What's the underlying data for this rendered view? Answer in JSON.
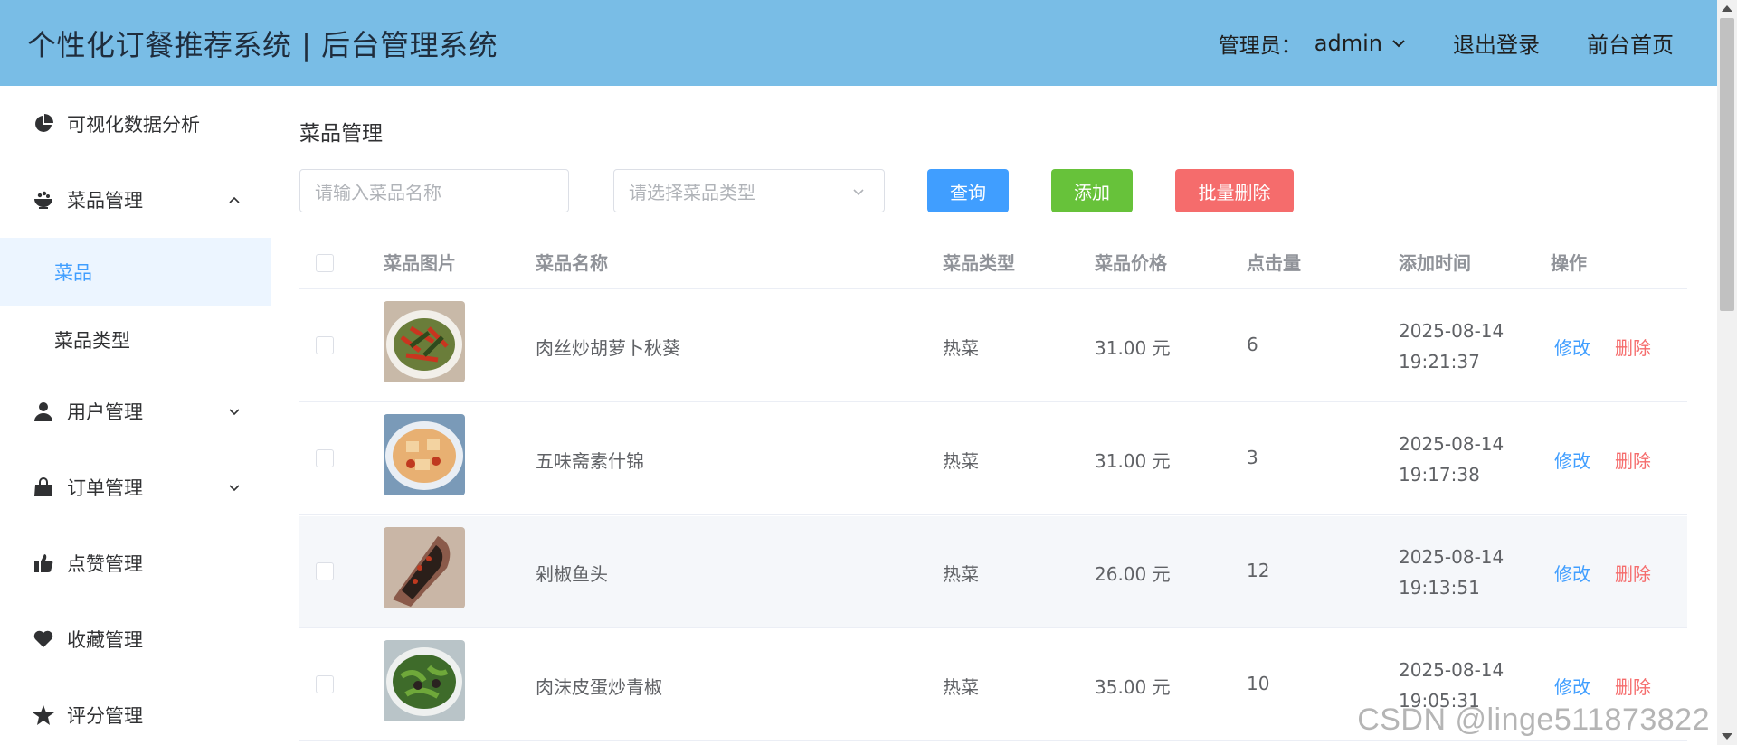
{
  "header": {
    "title": "个性化订餐推荐系统 | 后台管理系统",
    "admin_label": "管理员：",
    "admin_name": "admin",
    "logout": "退出登录",
    "frontend": "前台首页",
    "bg_color": "#79bde6"
  },
  "sidebar": {
    "items": [
      {
        "label": "可视化数据分析",
        "icon": "pie-chart-icon"
      },
      {
        "label": "菜品管理",
        "icon": "bowl-icon",
        "expanded": true
      },
      {
        "label": "菜品",
        "sub": true,
        "active": true
      },
      {
        "label": "菜品类型",
        "sub": true
      },
      {
        "label": "用户管理",
        "icon": "user-icon"
      },
      {
        "label": "订单管理",
        "icon": "bag-icon"
      },
      {
        "label": "点赞管理",
        "icon": "thumbs-up-icon"
      },
      {
        "label": "收藏管理",
        "icon": "heart-icon"
      },
      {
        "label": "评分管理",
        "icon": "star-icon"
      }
    ]
  },
  "main": {
    "title": "菜品管理",
    "search_placeholder": "请输入菜品名称",
    "select_placeholder": "请选择菜品类型",
    "query_label": "查询",
    "add_label": "添加",
    "bulk_delete_label": "批量删除"
  },
  "table": {
    "headers": [
      "菜品图片",
      "菜品名称",
      "菜品类型",
      "菜品价格",
      "点击量",
      "添加时间",
      "操作"
    ],
    "rows": [
      {
        "name": "肉丝炒胡萝卜秋葵",
        "type": "热菜",
        "price": "31.00 元",
        "clicks": "6",
        "date": "2025-08-14",
        "time": "19:21:37",
        "edit": "修改",
        "delete": "删除"
      },
      {
        "name": "五味斋素什锦",
        "type": "热菜",
        "price": "31.00 元",
        "clicks": "3",
        "date": "2025-08-14",
        "time": "19:17:38",
        "edit": "修改",
        "delete": "删除"
      },
      {
        "name": "剁椒鱼头",
        "type": "热菜",
        "price": "26.00 元",
        "clicks": "12",
        "date": "2025-08-14",
        "time": "19:13:51",
        "edit": "修改",
        "delete": "删除"
      },
      {
        "name": "肉沫皮蛋炒青椒",
        "type": "热菜",
        "price": "35.00 元",
        "clicks": "10",
        "date": "2025-08-14",
        "time": "19:05:31",
        "edit": "修改",
        "delete": "删除"
      }
    ]
  },
  "watermark": "CSDN @linge511873822"
}
